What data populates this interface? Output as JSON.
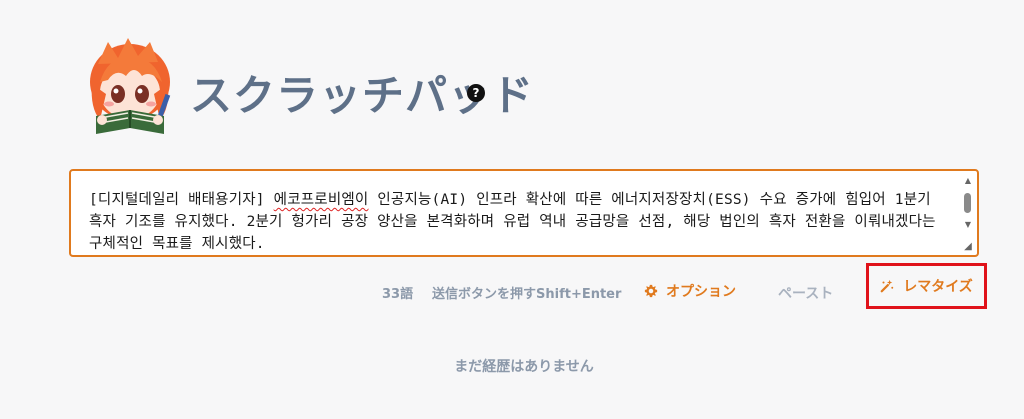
{
  "header": {
    "title": "スクラッチパッド",
    "help_icon": "question-circle-icon",
    "help_label": "?",
    "mascot_icon": "reading-girl-mascot"
  },
  "editor": {
    "text_part1": "[디지털데일리 배태용기자] ",
    "text_misspelled": "에코프로비엠이",
    "text_part2": " 인공지능(AI) 인프라 확산에 따른 에너지저장장치(ESS) 수요 증가에 힘입어 1분기 흑자 기조를 유지했다. 2분기 헝가리 공장 양산을 본격화하며 유럽 역내 공급망을 선점, 해당 법인의 흑자 전환을 이뤄내겠다는 구체적인 목표를 제시했다."
  },
  "toolbar": {
    "word_count": "33語",
    "hint": "送信ボタンを押すShift+Enter",
    "options_label": "オプション",
    "options_icon": "gear-icon",
    "paste_label": "ペースト",
    "lemmatize_label": "レマタイズ",
    "lemmatize_icon": "magic-wand-icon"
  },
  "history": {
    "empty_text": "まだ経歴はありません"
  },
  "colors": {
    "accent": "#e07a1e",
    "title": "#5e7088",
    "muted": "#8c99aa",
    "highlight_border": "#e0121a"
  }
}
